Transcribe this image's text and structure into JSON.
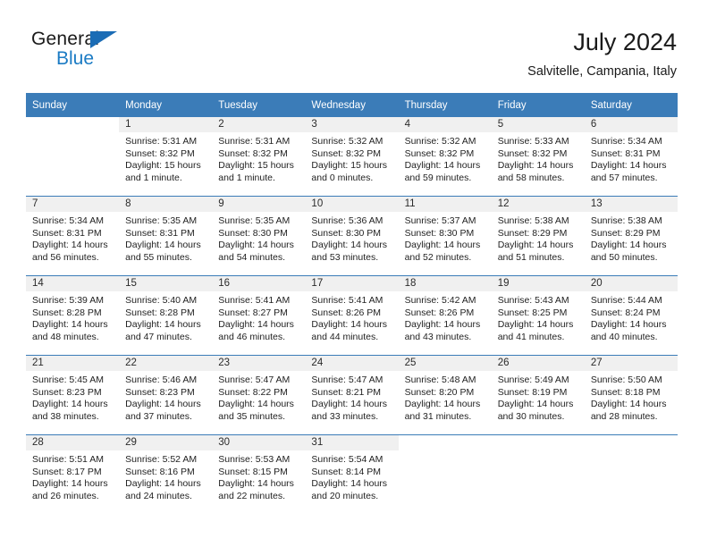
{
  "brand": {
    "name_top": "General",
    "name_bottom": "Blue",
    "triangle_color": "#1b6cb5",
    "blue_color": "#1b7bc4"
  },
  "header": {
    "title": "July 2024",
    "subtitle": "Salvitelle, Campania, Italy"
  },
  "theme": {
    "header_bg": "#3b7cb8",
    "daynum_bg": "#f0f0f0",
    "row_divider": "#3b7cb8"
  },
  "weekday_headers": [
    "Sunday",
    "Monday",
    "Tuesday",
    "Wednesday",
    "Thursday",
    "Friday",
    "Saturday"
  ],
  "weeks": [
    [
      {
        "day": "",
        "lines": []
      },
      {
        "day": "1",
        "lines": [
          "Sunrise: 5:31 AM",
          "Sunset: 8:32 PM",
          "Daylight: 15 hours",
          "and 1 minute."
        ]
      },
      {
        "day": "2",
        "lines": [
          "Sunrise: 5:31 AM",
          "Sunset: 8:32 PM",
          "Daylight: 15 hours",
          "and 1 minute."
        ]
      },
      {
        "day": "3",
        "lines": [
          "Sunrise: 5:32 AM",
          "Sunset: 8:32 PM",
          "Daylight: 15 hours",
          "and 0 minutes."
        ]
      },
      {
        "day": "4",
        "lines": [
          "Sunrise: 5:32 AM",
          "Sunset: 8:32 PM",
          "Daylight: 14 hours",
          "and 59 minutes."
        ]
      },
      {
        "day": "5",
        "lines": [
          "Sunrise: 5:33 AM",
          "Sunset: 8:32 PM",
          "Daylight: 14 hours",
          "and 58 minutes."
        ]
      },
      {
        "day": "6",
        "lines": [
          "Sunrise: 5:34 AM",
          "Sunset: 8:31 PM",
          "Daylight: 14 hours",
          "and 57 minutes."
        ]
      }
    ],
    [
      {
        "day": "7",
        "lines": [
          "Sunrise: 5:34 AM",
          "Sunset: 8:31 PM",
          "Daylight: 14 hours",
          "and 56 minutes."
        ]
      },
      {
        "day": "8",
        "lines": [
          "Sunrise: 5:35 AM",
          "Sunset: 8:31 PM",
          "Daylight: 14 hours",
          "and 55 minutes."
        ]
      },
      {
        "day": "9",
        "lines": [
          "Sunrise: 5:35 AM",
          "Sunset: 8:30 PM",
          "Daylight: 14 hours",
          "and 54 minutes."
        ]
      },
      {
        "day": "10",
        "lines": [
          "Sunrise: 5:36 AM",
          "Sunset: 8:30 PM",
          "Daylight: 14 hours",
          "and 53 minutes."
        ]
      },
      {
        "day": "11",
        "lines": [
          "Sunrise: 5:37 AM",
          "Sunset: 8:30 PM",
          "Daylight: 14 hours",
          "and 52 minutes."
        ]
      },
      {
        "day": "12",
        "lines": [
          "Sunrise: 5:38 AM",
          "Sunset: 8:29 PM",
          "Daylight: 14 hours",
          "and 51 minutes."
        ]
      },
      {
        "day": "13",
        "lines": [
          "Sunrise: 5:38 AM",
          "Sunset: 8:29 PM",
          "Daylight: 14 hours",
          "and 50 minutes."
        ]
      }
    ],
    [
      {
        "day": "14",
        "lines": [
          "Sunrise: 5:39 AM",
          "Sunset: 8:28 PM",
          "Daylight: 14 hours",
          "and 48 minutes."
        ]
      },
      {
        "day": "15",
        "lines": [
          "Sunrise: 5:40 AM",
          "Sunset: 8:28 PM",
          "Daylight: 14 hours",
          "and 47 minutes."
        ]
      },
      {
        "day": "16",
        "lines": [
          "Sunrise: 5:41 AM",
          "Sunset: 8:27 PM",
          "Daylight: 14 hours",
          "and 46 minutes."
        ]
      },
      {
        "day": "17",
        "lines": [
          "Sunrise: 5:41 AM",
          "Sunset: 8:26 PM",
          "Daylight: 14 hours",
          "and 44 minutes."
        ]
      },
      {
        "day": "18",
        "lines": [
          "Sunrise: 5:42 AM",
          "Sunset: 8:26 PM",
          "Daylight: 14 hours",
          "and 43 minutes."
        ]
      },
      {
        "day": "19",
        "lines": [
          "Sunrise: 5:43 AM",
          "Sunset: 8:25 PM",
          "Daylight: 14 hours",
          "and 41 minutes."
        ]
      },
      {
        "day": "20",
        "lines": [
          "Sunrise: 5:44 AM",
          "Sunset: 8:24 PM",
          "Daylight: 14 hours",
          "and 40 minutes."
        ]
      }
    ],
    [
      {
        "day": "21",
        "lines": [
          "Sunrise: 5:45 AM",
          "Sunset: 8:23 PM",
          "Daylight: 14 hours",
          "and 38 minutes."
        ]
      },
      {
        "day": "22",
        "lines": [
          "Sunrise: 5:46 AM",
          "Sunset: 8:23 PM",
          "Daylight: 14 hours",
          "and 37 minutes."
        ]
      },
      {
        "day": "23",
        "lines": [
          "Sunrise: 5:47 AM",
          "Sunset: 8:22 PM",
          "Daylight: 14 hours",
          "and 35 minutes."
        ]
      },
      {
        "day": "24",
        "lines": [
          "Sunrise: 5:47 AM",
          "Sunset: 8:21 PM",
          "Daylight: 14 hours",
          "and 33 minutes."
        ]
      },
      {
        "day": "25",
        "lines": [
          "Sunrise: 5:48 AM",
          "Sunset: 8:20 PM",
          "Daylight: 14 hours",
          "and 31 minutes."
        ]
      },
      {
        "day": "26",
        "lines": [
          "Sunrise: 5:49 AM",
          "Sunset: 8:19 PM",
          "Daylight: 14 hours",
          "and 30 minutes."
        ]
      },
      {
        "day": "27",
        "lines": [
          "Sunrise: 5:50 AM",
          "Sunset: 8:18 PM",
          "Daylight: 14 hours",
          "and 28 minutes."
        ]
      }
    ],
    [
      {
        "day": "28",
        "lines": [
          "Sunrise: 5:51 AM",
          "Sunset: 8:17 PM",
          "Daylight: 14 hours",
          "and 26 minutes."
        ]
      },
      {
        "day": "29",
        "lines": [
          "Sunrise: 5:52 AM",
          "Sunset: 8:16 PM",
          "Daylight: 14 hours",
          "and 24 minutes."
        ]
      },
      {
        "day": "30",
        "lines": [
          "Sunrise: 5:53 AM",
          "Sunset: 8:15 PM",
          "Daylight: 14 hours",
          "and 22 minutes."
        ]
      },
      {
        "day": "31",
        "lines": [
          "Sunrise: 5:54 AM",
          "Sunset: 8:14 PM",
          "Daylight: 14 hours",
          "and 20 minutes."
        ]
      },
      {
        "day": "",
        "lines": []
      },
      {
        "day": "",
        "lines": []
      },
      {
        "day": "",
        "lines": []
      }
    ]
  ]
}
